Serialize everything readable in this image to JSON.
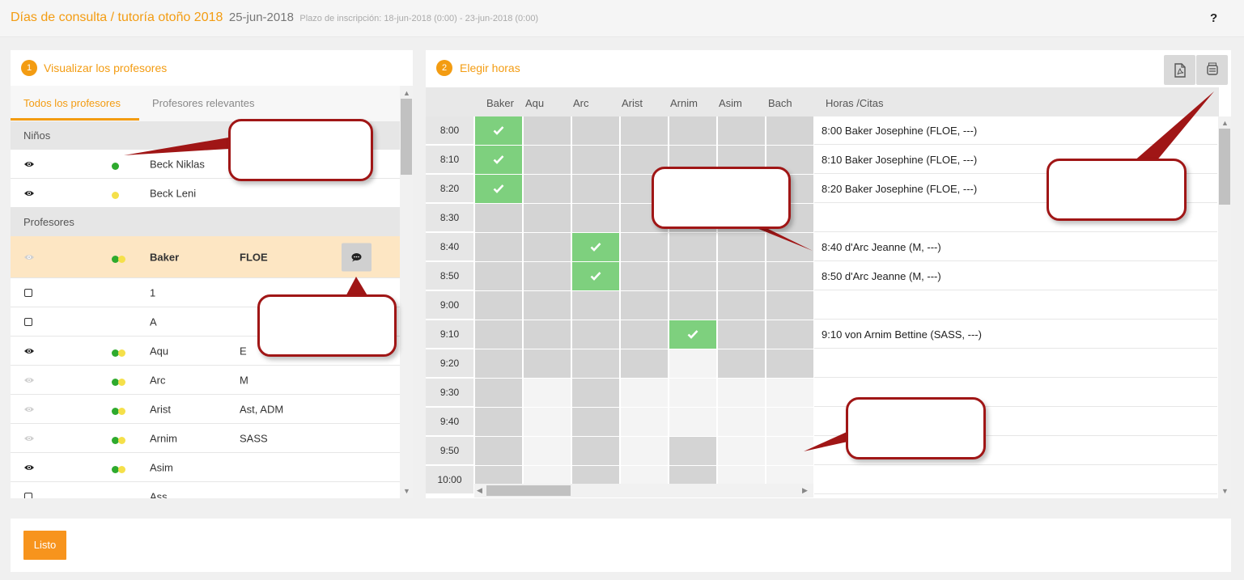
{
  "header": {
    "title": "Días de consulta / tutoría otoño 2018",
    "date": "25-jun-2018",
    "plazo": "Plazo de inscripción: 18-jun-2018 (0:00) - 23-jun-2018 (0:00)",
    "help": "?"
  },
  "left_panel": {
    "step": "1",
    "title": "Visualizar los profesores",
    "tabs": [
      "Todos los profesores",
      "Profesores relevantes"
    ],
    "group_children": "Niños",
    "children": [
      {
        "name": "Beck Niklas",
        "icon": "eye-icon",
        "dots": "green"
      },
      {
        "name": "Beck Leni",
        "icon": "eye-icon",
        "dots": "yellow"
      }
    ],
    "group_teachers": "Profesores",
    "teachers": [
      {
        "name": "Baker",
        "subject": "FLOE",
        "icon": "eye-faded-icon",
        "dots": "green-yellow"
      },
      {
        "name": "1",
        "subject": "",
        "icon": "checkbox",
        "dots": ""
      },
      {
        "name": "A",
        "subject": "",
        "icon": "checkbox",
        "dots": ""
      },
      {
        "name": "Aqu",
        "subject": "E",
        "icon": "eye-icon",
        "dots": "green-yellow"
      },
      {
        "name": "Arc",
        "subject": "M",
        "icon": "eye-faded-icon",
        "dots": "green-yellow"
      },
      {
        "name": "Arist",
        "subject": "Ast, ADM",
        "icon": "eye-faded-icon",
        "dots": "green-yellow"
      },
      {
        "name": "Arnim",
        "subject": "SASS",
        "icon": "eye-faded-icon",
        "dots": "green-yellow"
      },
      {
        "name": "Asim",
        "subject": "",
        "icon": "eye-icon",
        "dots": "green-yellow"
      },
      {
        "name": "Ass",
        "subject": "",
        "icon": "checkbox",
        "dots": ""
      }
    ]
  },
  "right_panel": {
    "step": "2",
    "title": "Elegir horas",
    "buttons": [
      "pdf-icon",
      "print-icon"
    ],
    "columns": [
      "Baker",
      "Aqu",
      "Arc",
      "Arist",
      "Arnim",
      "Asim",
      "Bach"
    ],
    "appointments_header": "Horas /Citas",
    "rows": [
      {
        "time": "8:00",
        "cells": [
          "booked",
          "busy",
          "busy",
          "busy",
          "busy",
          "busy",
          "busy"
        ],
        "appointment": "8:00 Baker Josephine (FLOE, ---)"
      },
      {
        "time": "8:10",
        "cells": [
          "booked",
          "busy",
          "busy",
          "busy",
          "busy",
          "busy",
          "busy"
        ],
        "appointment": "8:10 Baker Josephine (FLOE, ---)"
      },
      {
        "time": "8:20",
        "cells": [
          "booked",
          "busy",
          "busy",
          "busy",
          "busy",
          "busy",
          "busy"
        ],
        "appointment": "8:20 Baker Josephine (FLOE, ---)"
      },
      {
        "time": "8:30",
        "cells": [
          "busy",
          "busy",
          "busy",
          "busy",
          "busy",
          "busy",
          "busy"
        ],
        "appointment": ""
      },
      {
        "time": "8:40",
        "cells": [
          "busy",
          "busy",
          "booked",
          "busy",
          "busy",
          "busy",
          "busy"
        ],
        "appointment": "8:40 d'Arc Jeanne (M, ---)"
      },
      {
        "time": "8:50",
        "cells": [
          "busy",
          "busy",
          "booked",
          "busy",
          "busy",
          "busy",
          "busy"
        ],
        "appointment": "8:50 d'Arc Jeanne (M, ---)"
      },
      {
        "time": "9:00",
        "cells": [
          "busy",
          "busy",
          "busy",
          "busy",
          "busy",
          "busy",
          "busy"
        ],
        "appointment": ""
      },
      {
        "time": "9:10",
        "cells": [
          "busy",
          "busy",
          "busy",
          "busy",
          "booked",
          "busy",
          "busy"
        ],
        "appointment": "9:10 von Arnim Bettine (SASS, ---)"
      },
      {
        "time": "9:20",
        "cells": [
          "busy",
          "busy",
          "busy",
          "busy",
          "free",
          "busy",
          "busy"
        ],
        "appointment": ""
      },
      {
        "time": "9:30",
        "cells": [
          "busy",
          "free",
          "busy",
          "free",
          "free",
          "free",
          "free"
        ],
        "appointment": ""
      },
      {
        "time": "9:40",
        "cells": [
          "busy",
          "free",
          "busy",
          "free",
          "free",
          "free",
          "free"
        ],
        "appointment": ""
      },
      {
        "time": "9:50",
        "cells": [
          "busy",
          "free",
          "busy",
          "free",
          "busy",
          "free",
          "free"
        ],
        "appointment": ""
      },
      {
        "time": "10:00",
        "cells": [
          "busy",
          "free",
          "busy",
          "free",
          "busy",
          "free",
          "free"
        ],
        "appointment": ""
      }
    ]
  },
  "footer": {
    "done_label": "Listo"
  },
  "colors": {
    "accent": "#f39c12",
    "booked": "#7ed07e",
    "busy": "#d4d4d4",
    "callout_border": "#a01616"
  }
}
